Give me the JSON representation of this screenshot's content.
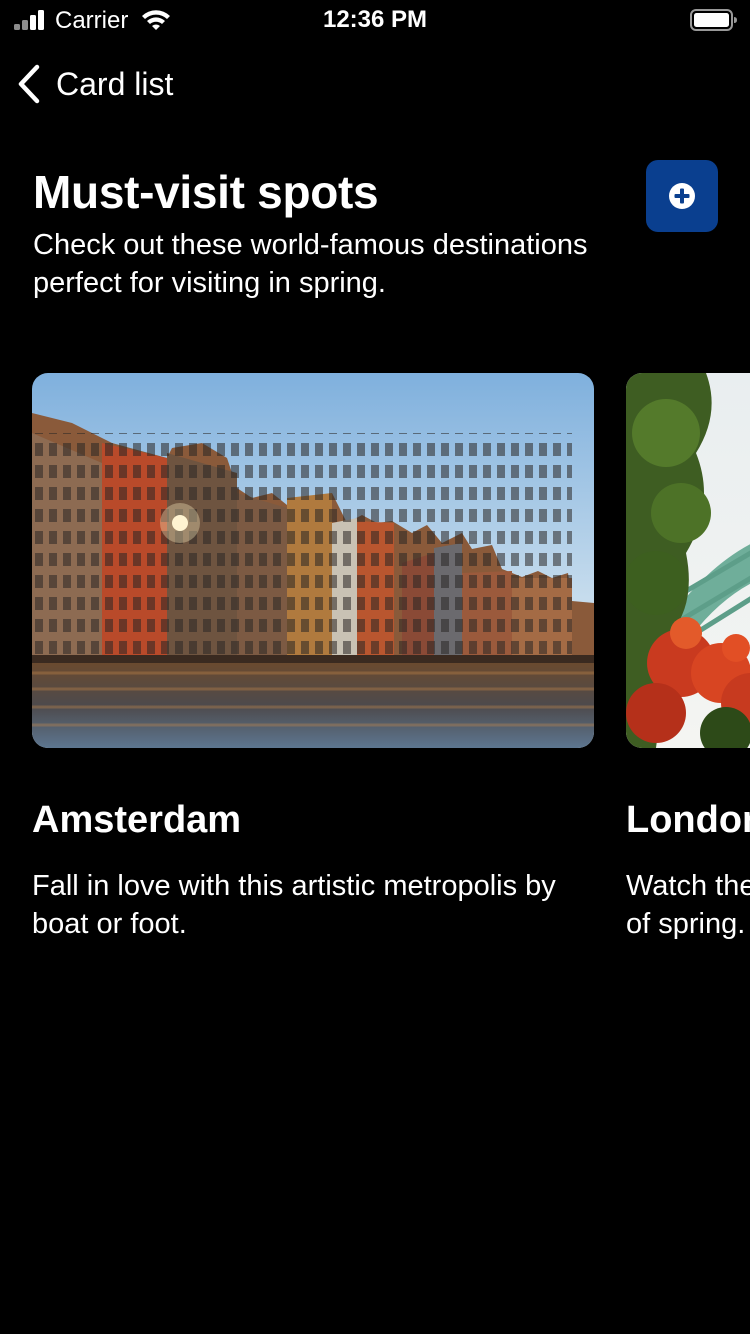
{
  "status_bar": {
    "carrier": "Carrier",
    "time": "12:36 PM",
    "icons": [
      "signal-icon",
      "wifi-icon",
      "battery-icon"
    ]
  },
  "navigation": {
    "back_label": "Card list",
    "back_icon": "chevron-left-icon"
  },
  "header": {
    "title": "Must-visit spots",
    "subtitle": "Check out these world-famous destinations perfect for visiting in spring.",
    "add_button_icon": "plus-circle-icon"
  },
  "cards": [
    {
      "title": "Amsterdam",
      "description": "Fall in love with this artistic metropolis by boat or foot.",
      "image": "amsterdam-canal-houses-photo"
    },
    {
      "title": "London",
      "description": "Watch the blossoms unfold in the warmth of spring.",
      "image": "london-bridge-flowers-photo"
    }
  ],
  "colors": {
    "background": "#000000",
    "text": "#ffffff",
    "accent": "#0a3f8f"
  }
}
